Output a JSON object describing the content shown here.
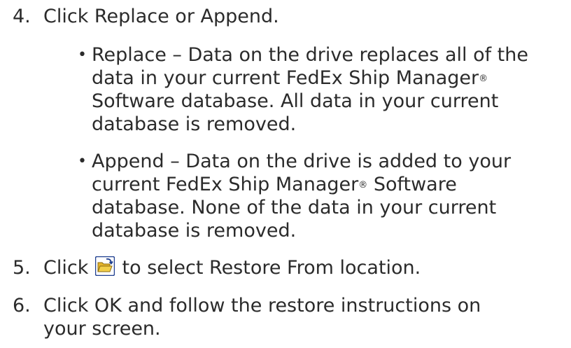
{
  "steps": [
    {
      "number": "4.",
      "lines": [
        "Click Replace or Append."
      ],
      "bullets": [
        {
          "marker": "•",
          "lines": [
            "Replace – Data on the drive replaces all of the",
            "data in your current FedEx Ship Manager",
            "Software database. All data in your current",
            "database is removed."
          ],
          "reg_mark": "®"
        },
        {
          "marker": "•",
          "lines": [
            "Append – Data on the drive is added to your",
            "current FedEx Ship Manager",
            "Software",
            "database. None of the data in your current",
            "database is removed."
          ],
          "reg_mark": "®"
        }
      ]
    },
    {
      "number": "5.",
      "before_icon": "Click",
      "icon": "open-folder-icon",
      "after_icon": "to select Restore From location."
    },
    {
      "number": "6.",
      "lines": [
        "Click OK and follow the restore instructions on",
        "your screen."
      ]
    }
  ],
  "colors": {
    "text": "#2b2b2b",
    "icon_border": "#1f3f8f",
    "icon_fill": "#f2cf4a"
  }
}
